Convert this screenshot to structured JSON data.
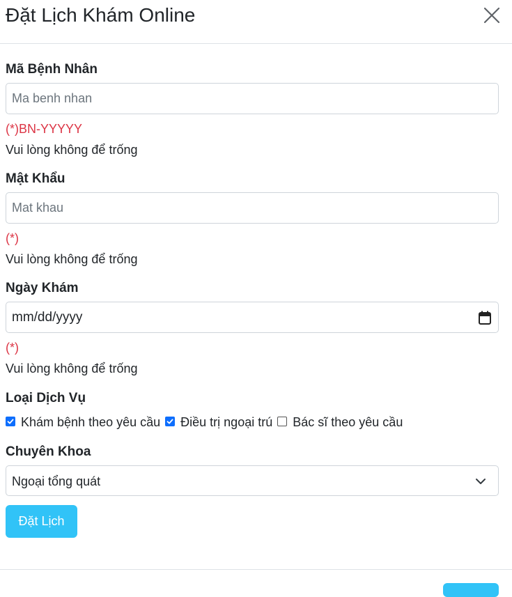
{
  "modal": {
    "title": "Đặt Lịch Khám Online",
    "close_icon": "close-icon"
  },
  "form": {
    "patient_id": {
      "label": "Mã Bệnh Nhân",
      "placeholder": "Ma benh nhan",
      "value": "",
      "hint": "(*)BN-YYYYY",
      "warning": "Vui lòng không để trống"
    },
    "password": {
      "label": "Mật Khẩu",
      "placeholder": "Mat khau",
      "value": "",
      "hint": "(*)",
      "warning": "Vui lòng không để trống"
    },
    "date": {
      "label": "Ngày Khám",
      "value": "mm/dd/yyyy",
      "icon": "calendar-icon",
      "hint": "(*)",
      "warning": "Vui lòng không để trống"
    },
    "services": {
      "label": "Loại Dịch Vụ",
      "options": [
        {
          "label": "Khám bệnh theo yêu cầu",
          "checked": true
        },
        {
          "label": "Điều trị ngoại trú",
          "checked": true
        },
        {
          "label": "Bác sĩ theo yêu cầu",
          "checked": false
        }
      ]
    },
    "specialty": {
      "label": "Chuyên Khoa",
      "selected": "Ngoại tổng quát",
      "icon": "chevron-down-icon"
    },
    "submit_label": "Đặt Lịch"
  },
  "colors": {
    "accent": "#31c3f7",
    "error": "#dc3545",
    "checkbox": "#0d6efd"
  }
}
